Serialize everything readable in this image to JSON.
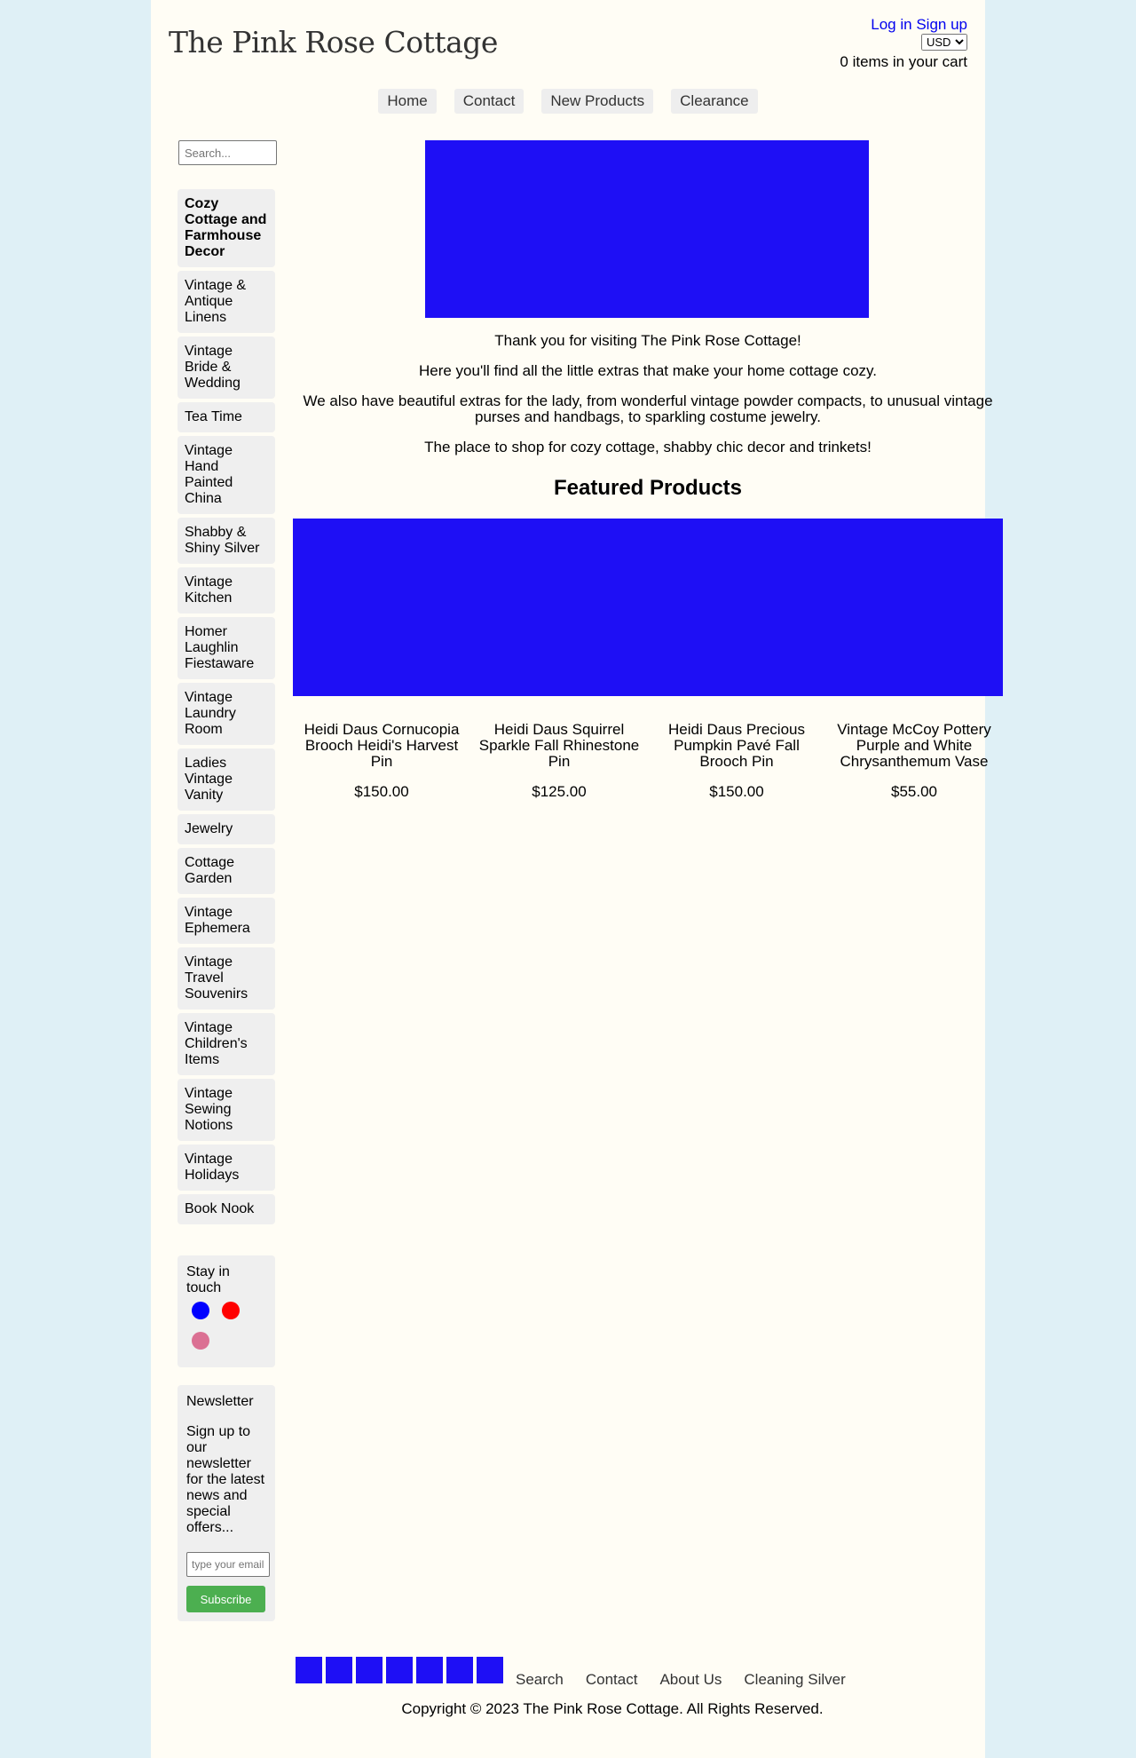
{
  "header": {
    "site_title": "The Pink Rose Cottage",
    "login_label": "Log in",
    "signup_label": "Sign up",
    "currency_selected": "USD",
    "cart_text": "0 items in your cart"
  },
  "nav": {
    "items": [
      "Home",
      "Contact",
      "New Products",
      "Clearance"
    ]
  },
  "sidebar": {
    "search_placeholder": "Search...",
    "categories": [
      "Cozy Cottage and Farmhouse Decor",
      "Vintage & Antique Linens",
      "Vintage Bride & Wedding",
      "Tea Time",
      "Vintage Hand Painted China",
      "Shabby & Shiny Silver",
      "Vintage Kitchen",
      "Homer Laughlin Fiestaware",
      "Vintage Laundry Room",
      "Ladies Vintage Vanity",
      "Jewelry",
      "Cottage Garden",
      "Vintage Ephemera",
      "Vintage Travel Souvenirs",
      "Vintage Children's Items",
      "Vintage Sewing Notions",
      "Vintage Holidays",
      "Book Nook"
    ],
    "stay_in_touch_title": "Stay in touch",
    "social_colors": [
      "#0000ff",
      "#ff0000",
      "#db7093"
    ],
    "newsletter": {
      "title": "Newsletter",
      "text": "Sign up to our newsletter for the latest news and special offers...",
      "email_placeholder": "type your email",
      "subscribe_label": "Subscribe"
    }
  },
  "main": {
    "intro": [
      "Thank you for visiting The Pink Rose Cottage!",
      "Here you'll find all the little extras that make your home cottage cozy.",
      "We also have beautiful extras for the lady, from wonderful vintage powder compacts, to unusual vintage purses and handbags, to sparkling costume jewelry.",
      "The place to shop for cozy cottage, shabby chic decor and trinkets!"
    ],
    "featured_title": "Featured Products",
    "products": [
      {
        "name": "Heidi Daus Cornucopia Brooch Heidi's Harvest Pin",
        "price": "$150.00"
      },
      {
        "name": "Heidi Daus Squirrel Sparkle Fall Rhinestone Pin",
        "price": "$125.00"
      },
      {
        "name": "Heidi Daus Precious Pumpkin Pavé Fall Brooch Pin",
        "price": "$150.00"
      },
      {
        "name": "Vintage McCoy Pottery Purple and White Chrysanthemum Vase",
        "price": "$55.00"
      }
    ]
  },
  "footer": {
    "links": [
      "Search",
      "Contact",
      "About Us",
      "Cleaning Silver"
    ],
    "copyright": "Copyright © 2023 The Pink Rose Cottage. All Rights Reserved."
  },
  "colors": {
    "page_bg": "#dff0f6",
    "content_bg": "#fffdf5",
    "placeholder_image": "#1e0ff5",
    "subscribe_button": "#4caf50",
    "link": "#0000ee"
  }
}
